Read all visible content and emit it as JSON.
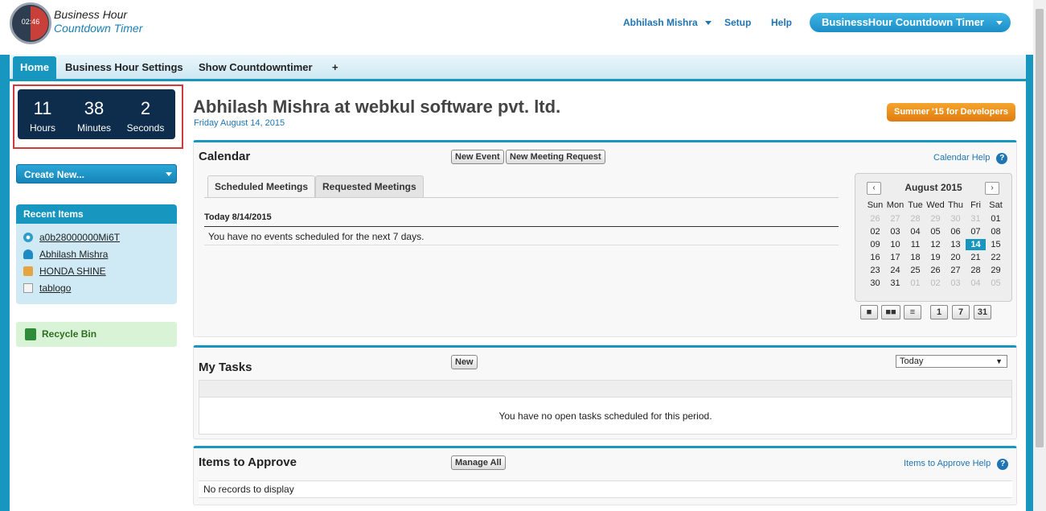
{
  "header": {
    "logo_time": "02:46",
    "logo_line1": "Business Hour",
    "logo_line2": "Countdown Timer",
    "user_menu": "Abhilash Mishra",
    "setup": "Setup",
    "help": "Help",
    "app_menu": "BusinessHour Countdown Timer"
  },
  "tabs": [
    "Home",
    "Business Hour Settings",
    "Show Countdowntimer",
    "+"
  ],
  "timer": {
    "hours_value": "11",
    "hours_label": "Hours",
    "minutes_value": "38",
    "minutes_label": "Minutes",
    "seconds_value": "2",
    "seconds_label": "Seconds"
  },
  "sidebar": {
    "create_new": "Create New...",
    "recent_items_title": "Recent Items",
    "recent_items": [
      "a0b28000000Mi6T",
      "Abhilash Mishra",
      "HONDA SHINE",
      "tablogo"
    ],
    "recycle_bin": "Recycle Bin"
  },
  "page": {
    "title": "Abhilash Mishra at webkul software pvt. ltd.",
    "date": "Friday August 14, 2015",
    "promo": "Summer '15 for Developers"
  },
  "calendar": {
    "title": "Calendar",
    "new_event": "New Event",
    "new_meeting": "New Meeting Request",
    "help": "Calendar Help",
    "tab_scheduled": "Scheduled Meetings",
    "tab_requested": "Requested Meetings",
    "today_label": "Today 8/14/2015",
    "no_events": "You have no events scheduled for the next 7 days.",
    "month_label": "August 2015",
    "weekdays": [
      "Sun",
      "Mon",
      "Tue",
      "Wed",
      "Thu",
      "Fri",
      "Sat"
    ],
    "weeks": [
      [
        "26",
        "27",
        "28",
        "29",
        "30",
        "31",
        "01"
      ],
      [
        "02",
        "03",
        "04",
        "05",
        "06",
        "07",
        "08"
      ],
      [
        "09",
        "10",
        "11",
        "12",
        "13",
        "14",
        "15"
      ],
      [
        "16",
        "17",
        "18",
        "19",
        "20",
        "21",
        "22"
      ],
      [
        "23",
        "24",
        "25",
        "26",
        "27",
        "28",
        "29"
      ],
      [
        "30",
        "31",
        "01",
        "02",
        "03",
        "04",
        "05"
      ]
    ],
    "today_day": "14",
    "view_buttons": [
      "1",
      "7",
      "31"
    ]
  },
  "tasks": {
    "title": "My Tasks",
    "new": "New",
    "period": "Today",
    "empty": "You have no open tasks scheduled for this period."
  },
  "approvals": {
    "title": "Items to Approve",
    "manage_all": "Manage All",
    "help": "Items to Approve Help",
    "empty": "No records to display"
  }
}
